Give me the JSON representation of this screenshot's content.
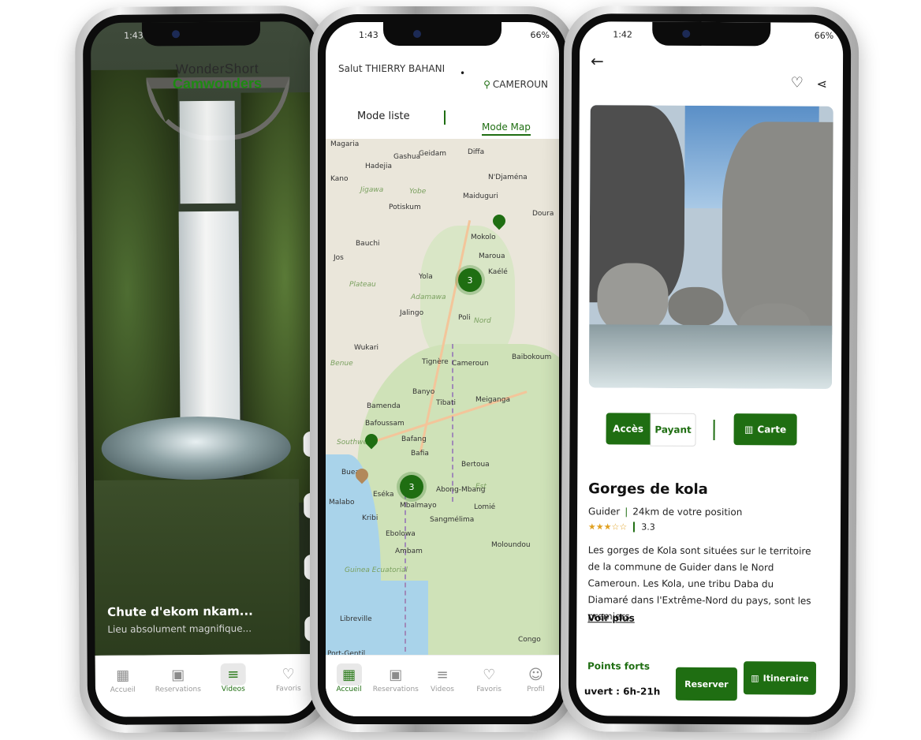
{
  "phone1": {
    "status_time": "1:43",
    "brand_line1": "WonderShort",
    "brand_line2": "Camwonders",
    "video_title": "Chute d'ekom nkam...",
    "video_subtitle": "Lieu absolument magnifique...",
    "nav": [
      {
        "label": "Accueil",
        "icon": "grid-icon"
      },
      {
        "label": "Reservations",
        "icon": "calendar-icon"
      },
      {
        "label": "Videos",
        "icon": "playlist-icon"
      },
      {
        "label": "Favoris",
        "icon": "heart-icon"
      }
    ],
    "active_nav": "Videos"
  },
  "phone2": {
    "status_time": "1:43",
    "status_battery": "66%",
    "greeting": "Salut THIERRY BAHANI",
    "country": "CAMEROUN",
    "mode_list": "Mode liste",
    "mode_map": "Mode Map",
    "map_labels": [
      "Magaria",
      "Hadejia",
      "Gashua",
      "Geidam",
      "Diffa",
      "Kano",
      "Jigawa",
      "Yobe",
      "Maiduguri",
      "N'Djaména",
      "Potiskum",
      "Doura",
      "Bauchi",
      "Mokolo",
      "Maroua",
      "Jos",
      "Kaélé",
      "Plateau",
      "Adamawa",
      "Yola",
      "Poli",
      "Nord",
      "Jalingo",
      "Wukari",
      "Benue",
      "Tignère",
      "Cameroun",
      "Baibokoum",
      "Bamenda",
      "Banyo",
      "Tibati",
      "Meiganga",
      "Bafoussam",
      "Bafang",
      "Bafia",
      "Southwest",
      "Bertoua",
      "Buea",
      "Est",
      "Malabo",
      "Eséka",
      "Abong-Mbang",
      "Kribi",
      "Mbalmayo",
      "Lomié",
      "Ebolowa",
      "Sangmélima",
      "Moloundou",
      "Ambam",
      "Guinea Ecuatorial",
      "Libreville",
      "Congo",
      "Port-Gentil"
    ],
    "clusters": [
      "3",
      "3"
    ],
    "nav": [
      {
        "label": "Accueil",
        "icon": "grid-icon"
      },
      {
        "label": "Reservations",
        "icon": "calendar-icon"
      },
      {
        "label": "Videos",
        "icon": "playlist-icon"
      },
      {
        "label": "Favoris",
        "icon": "heart-icon"
      },
      {
        "label": "Profil",
        "icon": "person-icon"
      }
    ],
    "active_nav": "Accueil"
  },
  "phone3": {
    "status_time": "1:42",
    "status_battery": "66%",
    "acces_label": "Accès",
    "payant_label": "Payant",
    "carte_label": "Carte",
    "title": "Gorges de kola",
    "town": "Guider",
    "distance": "24km de votre position",
    "rating_value": "3.3",
    "rating_stars": 3.3,
    "description": "Les gorges de Kola sont situées sur le territoire de la commune de Guider dans le Nord Cameroun. Les Kola, une tribu Daba du Diamaré dans l'Extrême-Nord du pays, sont les premiers",
    "voir_plus": "Voir plus",
    "points_forts": "Points forts",
    "hours": "uvert : 6h-21h",
    "reserver_label": "Reserver",
    "itineraire_label": "Itineraire"
  },
  "colors": {
    "brand_green": "#1f6e12",
    "star": "#e0a020"
  }
}
